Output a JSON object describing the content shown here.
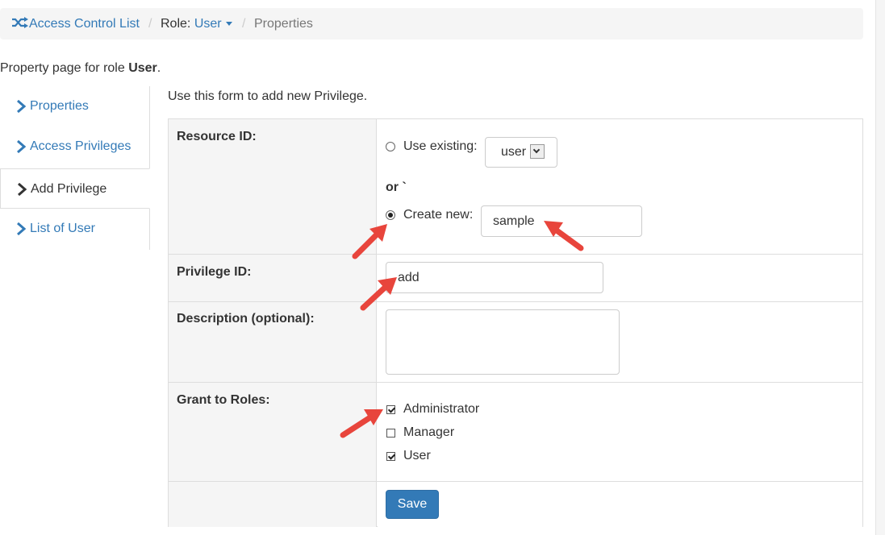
{
  "breadcrumb": {
    "root_label": "Access Control List",
    "separator": "/",
    "role_prefix": "Role:",
    "role_value": "User",
    "current": "Properties"
  },
  "intro": {
    "text_prefix": "Property page for role ",
    "role_name": "User",
    "text_suffix": "."
  },
  "side_nav": {
    "items": [
      {
        "label": "Properties",
        "active": false
      },
      {
        "label": "Access Privileges",
        "active": false
      },
      {
        "label": "Add Privilege",
        "active": true
      },
      {
        "label": "List of User",
        "active": false
      }
    ]
  },
  "form": {
    "intro": "Use this form to add new Privilege.",
    "resource": {
      "label": "Resource ID:",
      "use_existing_label": "Use existing:",
      "existing_value": "user",
      "or_text": "or `",
      "create_new_label": "Create new:",
      "create_new_value": "sample",
      "selected": "create_new"
    },
    "privilege": {
      "label": "Privilege ID:",
      "value": "add"
    },
    "description": {
      "label": "Description (optional):",
      "value": ""
    },
    "grant": {
      "label": "Grant to Roles:",
      "roles": [
        {
          "label": "Administrator",
          "checked": true
        },
        {
          "label": "Manager",
          "checked": false
        },
        {
          "label": "User",
          "checked": true
        }
      ]
    },
    "save_label": "Save"
  },
  "colors": {
    "link": "#337ab7",
    "annotation_arrow": "#e8453c",
    "primary_button": "#337ab7"
  }
}
